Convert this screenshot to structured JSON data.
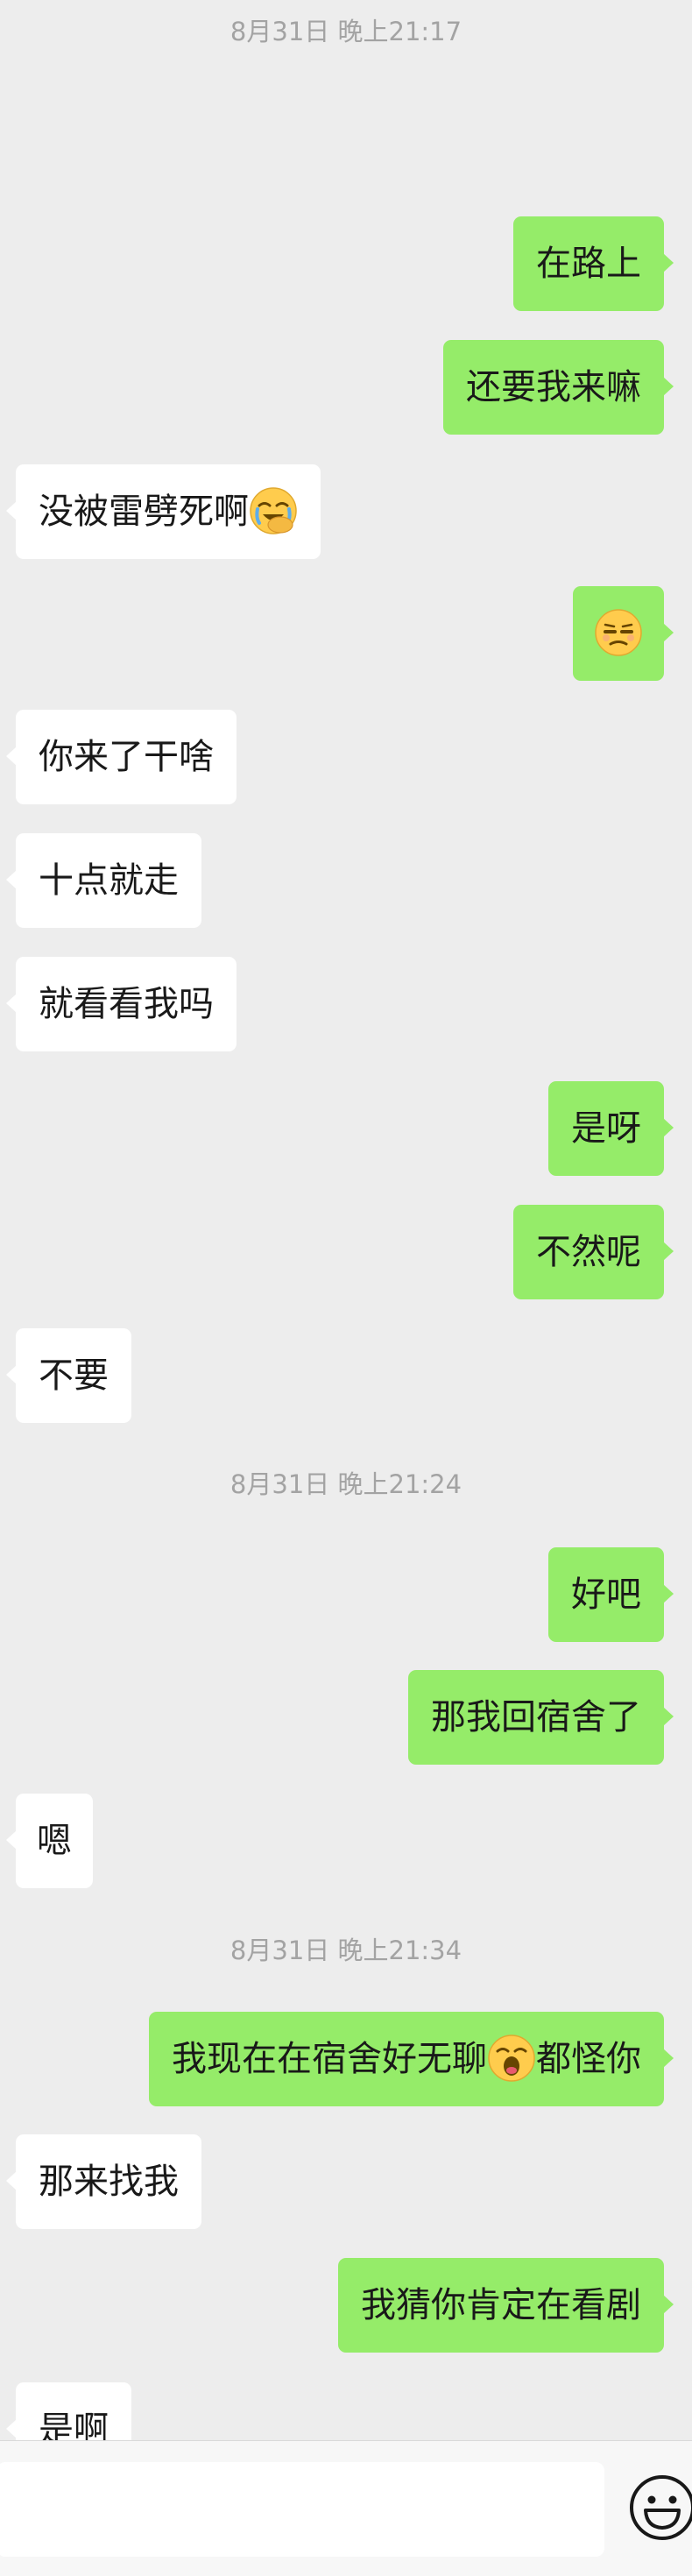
{
  "timestamps": {
    "t1": "8月31日 晚上21:17",
    "t2": "8月31日 晚上21:24",
    "t3": "8月31日 晚上21:34"
  },
  "messages": {
    "m1": {
      "side": "out",
      "text": "在路上"
    },
    "m2": {
      "side": "out",
      "text": "还要我来嘛"
    },
    "m3": {
      "side": "in",
      "text": "没被雷劈死啊",
      "emoji": "face-with-hand-over-mouth-laughing-emoji"
    },
    "m4": {
      "side": "out",
      "text": "",
      "emoji": "unamused-face-emoji"
    },
    "m5": {
      "side": "in",
      "text": "你来了干啥"
    },
    "m6": {
      "side": "in",
      "text": "十点就走"
    },
    "m7": {
      "side": "in",
      "text": "就看看我吗"
    },
    "m8": {
      "side": "out",
      "text": "是呀"
    },
    "m9": {
      "side": "out",
      "text": "不然呢"
    },
    "m10": {
      "side": "in",
      "text": "不要"
    },
    "m11": {
      "side": "out",
      "text": "好吧"
    },
    "m12": {
      "side": "out",
      "text": "那我回宿舍了"
    },
    "m13": {
      "side": "in",
      "text": "嗯"
    },
    "m14": {
      "side": "out",
      "text_before": "我现在在宿舍好无聊",
      "emoji": "yawning-face-emoji",
      "text_after": "都怪你"
    },
    "m15": {
      "side": "in",
      "text": "那来找我"
    },
    "m16": {
      "side": "out",
      "text": "我猜你肯定在看剧"
    },
    "m17": {
      "side": "in",
      "text": "是啊"
    }
  },
  "input_bar": {
    "input_value": "",
    "emoji_button_icon": "smiley-face-icon"
  },
  "colors": {
    "background": "#EDEDED",
    "outgoing_bubble": "#95EC69",
    "incoming_bubble": "#FFFFFF",
    "timestamp_text": "#A3A3A3",
    "message_text": "#191919"
  }
}
